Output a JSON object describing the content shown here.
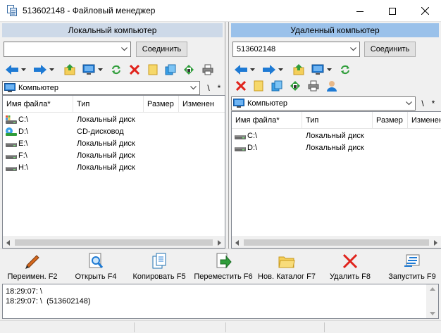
{
  "window": {
    "title": "513602148 - Файловый менеджер",
    "icon": "file-manager-icon"
  },
  "local": {
    "header": "Локальный компьютер",
    "host_value": "",
    "connect_label": "Соединить",
    "path_value": "Компьютер",
    "root_btn": "\\",
    "star_btn": "*",
    "columns": [
      "Имя файла*",
      "Тип",
      "Размер",
      "Изменен"
    ],
    "rows": [
      {
        "name": "C:\\",
        "type": "Локальный диск",
        "icon": "system-drive-icon"
      },
      {
        "name": "D:\\",
        "type": "CD-дисковод",
        "icon": "cd-drive-icon"
      },
      {
        "name": "E:\\",
        "type": "Локальный диск",
        "icon": "drive-icon"
      },
      {
        "name": "F:\\",
        "type": "Локальный диск",
        "icon": "drive-icon"
      },
      {
        "name": "H:\\",
        "type": "Локальный диск",
        "icon": "drive-icon"
      }
    ]
  },
  "remote": {
    "header": "Удаленный компьютер",
    "host_value": "513602148",
    "connect_label": "Соединить",
    "path_value": "Компьютер",
    "root_btn": "\\",
    "star_btn": "*",
    "columns": [
      "Имя файла*",
      "Тип",
      "Размер",
      "Изменен"
    ],
    "rows": [
      {
        "name": "C:\\",
        "type": "Локальный диск",
        "icon": "drive-icon"
      },
      {
        "name": "D:\\",
        "type": "Локальный диск",
        "icon": "drive-icon"
      }
    ]
  },
  "actions": [
    {
      "label": "Переимен. F2",
      "icon": "pencil-icon"
    },
    {
      "label": "Открыть F4",
      "icon": "open-icon"
    },
    {
      "label": "Копировать F5",
      "icon": "copy-icon"
    },
    {
      "label": "Переместить F6",
      "icon": "move-icon"
    },
    {
      "label": "Нов. Каталог F7",
      "icon": "new-folder-icon"
    },
    {
      "label": "Удалить F8",
      "icon": "delete-icon"
    },
    {
      "label": "Запустить F9",
      "icon": "run-icon"
    }
  ],
  "log": {
    "lines": [
      "18:29:07: \\",
      "18:29:07: \\  (513602148)"
    ]
  },
  "colors": {
    "local_header_bg": "#cdd9e8",
    "remote_header_bg": "#9ac1ea",
    "arrow_blue": "#1e7ad4",
    "delete_red": "#e0231c",
    "refresh_green": "#2f9d3a"
  }
}
